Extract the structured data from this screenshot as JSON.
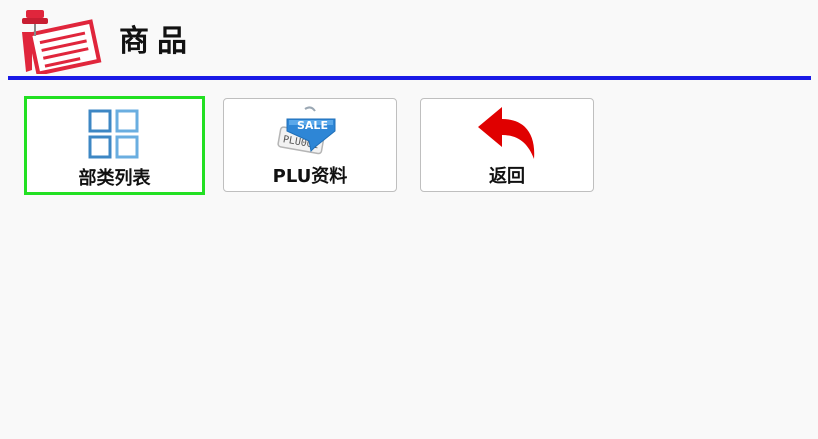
{
  "header": {
    "title": "商品",
    "icon": "memo-pin-icon"
  },
  "tiles": [
    {
      "label": "部类列表",
      "icon": "grid-icon",
      "selected": true
    },
    {
      "label": "PLU资料",
      "icon": "sale-tag-icon",
      "tag_text": "SALE",
      "tag_code": "PLU001",
      "selected": false
    },
    {
      "label": "返回",
      "icon": "back-arrow-icon",
      "selected": false
    }
  ],
  "colors": {
    "rule": "#1a1ae6",
    "selected_border": "#22e022",
    "back_arrow": "#e00000",
    "grid": "#3d87c4",
    "tag": "#2e86d6",
    "header_icon": "#e0263c"
  }
}
